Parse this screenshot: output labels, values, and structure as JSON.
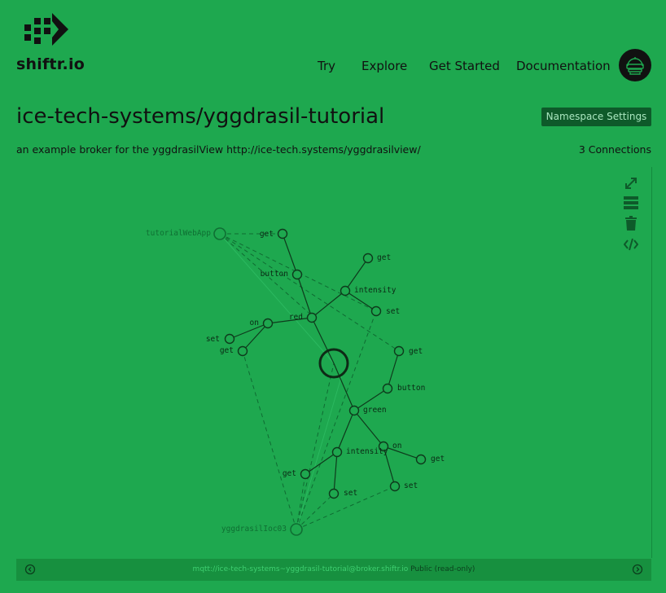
{
  "brand": {
    "name": "shiftr.io",
    "logo_icon": "shiftr-arrow-logo"
  },
  "nav": {
    "items": [
      "Try",
      "Explore",
      "Get Started",
      "Documentation"
    ],
    "avatar_icon": "robot-avatar-icon"
  },
  "page": {
    "title": "ice-tech-systems/yggdrasil-tutorial",
    "settings_button": "Namespace Settings",
    "description": "an example broker for the yggdrasilView http://ice-tech.systems/yggdrasilview/",
    "connections": "3 Connections"
  },
  "toolbar": {
    "icons": [
      "fullscreen-icon",
      "layout-list-icon",
      "trash-icon",
      "embed-code-icon"
    ]
  },
  "graph": {
    "clients": [
      "tutorialWebApp",
      "yggdrasilIoc03"
    ],
    "topics": [
      "get",
      "button",
      "get",
      "intensity",
      "set",
      "red",
      "on",
      "set",
      "get",
      "get",
      "button",
      "green",
      "on",
      "intensity",
      "get",
      "get",
      "set",
      "set"
    ]
  },
  "footer": {
    "url": "mqtt://ice-tech-systems~yggdrasil-tutorial@broker.shiftr.io",
    "mode": "Public (read-only)",
    "left_icon": "arrow-left-circle-icon",
    "right_icon": "arrow-right-circle-icon"
  },
  "colors": {
    "background": "#1ea84f",
    "button": "#0e5a2a",
    "footer": "#17903f",
    "ink": "#0d1a10"
  }
}
